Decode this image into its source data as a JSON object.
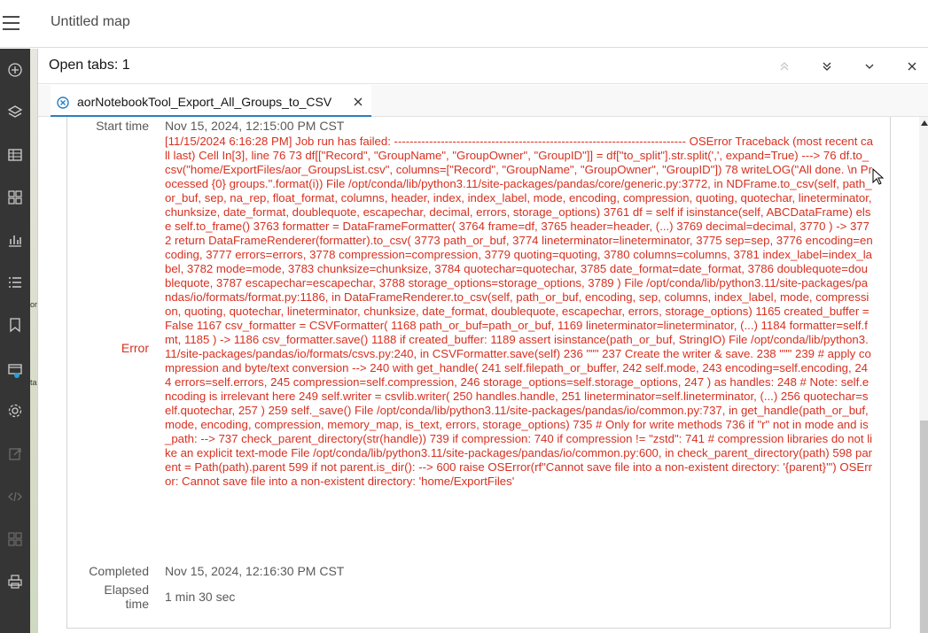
{
  "app": {
    "map_title": "Untitled map"
  },
  "sidebar": {
    "tools": [
      {
        "icon": "add-layer-icon"
      },
      {
        "icon": "layers-icon"
      },
      {
        "icon": "table-icon"
      },
      {
        "icon": "legend-icon"
      },
      {
        "icon": "charts-icon"
      },
      {
        "icon": "list-icon"
      },
      {
        "icon": "bookmark-icon"
      },
      {
        "icon": "task-monitor-icon"
      },
      {
        "icon": "settings-icon"
      },
      {
        "icon": "export-icon"
      },
      {
        "icon": "code-icon"
      },
      {
        "icon": "grid-icon"
      },
      {
        "icon": "print-icon"
      }
    ],
    "map_fragments": [
      "or",
      "ta"
    ]
  },
  "panel": {
    "open_tabs_label": "Open tabs: 1",
    "tab": {
      "label": "aorNotebookTool_Export_All_Groups_to_CSV",
      "status_icon": "failed-status-icon"
    }
  },
  "details": {
    "start_time_label": "Start time",
    "start_time_value": "Nov 15, 2024, 12:15:00 PM CST",
    "error_label": "Error",
    "error_text": "[11/15/2024 6:16:28 PM] Job run has failed: --------------------------------------------------------------------------- OSError Traceback (most recent call last) Cell In[3], line 76 73 df[[\"Record\", \"GroupName\", \"GroupOwner\", \"GroupID\"]] = df[\"to_split\"].str.split(',', expand=True) ---> 76 df.to_csv(\"home/ExportFiles/aor_GroupsList.csv\", columns=[\"Record\", \"GroupName\", \"GroupOwner\", \"GroupID\"]) 78 writeLOG(\"All done. \\n Processed {0} groups.\".format(i)) File /opt/conda/lib/python3.11/site-packages/pandas/core/generic.py:3772, in NDFrame.to_csv(self, path_or_buf, sep, na_rep, float_format, columns, header, index, index_label, mode, encoding, compression, quoting, quotechar, lineterminator, chunksize, date_format, doublequote, escapechar, decimal, errors, storage_options) 3761 df = self if isinstance(self, ABCDataFrame) else self.to_frame() 3763 formatter = DataFrameFormatter( 3764 frame=df, 3765 header=header, (...) 3769 decimal=decimal, 3770 ) -> 3772 return DataFrameRenderer(formatter).to_csv( 3773 path_or_buf, 3774 lineterminator=lineterminator, 3775 sep=sep, 3776 encoding=encoding, 3777 errors=errors, 3778 compression=compression, 3779 quoting=quoting, 3780 columns=columns, 3781 index_label=index_label, 3782 mode=mode, 3783 chunksize=chunksize, 3784 quotechar=quotechar, 3785 date_format=date_format, 3786 doublequote=doublequote, 3787 escapechar=escapechar, 3788 storage_options=storage_options, 3789 ) File /opt/conda/lib/python3.11/site-packages/pandas/io/formats/format.py:1186, in DataFrameRenderer.to_csv(self, path_or_buf, encoding, sep, columns, index_label, mode, compression, quoting, quotechar, lineterminator, chunksize, date_format, doublequote, escapechar, errors, storage_options) 1165 created_buffer = False 1167 csv_formatter = CSVFormatter( 1168 path_or_buf=path_or_buf, 1169 lineterminator=lineterminator, (...) 1184 formatter=self.fmt, 1185 ) -> 1186 csv_formatter.save() 1188 if created_buffer: 1189 assert isinstance(path_or_buf, StringIO) File /opt/conda/lib/python3.11/site-packages/pandas/io/formats/csvs.py:240, in CSVFormatter.save(self) 236 \"\"\" 237 Create the writer & save. 238 \"\"\" 239 # apply compression and byte/text conversion --> 240 with get_handle( 241 self.filepath_or_buffer, 242 self.mode, 243 encoding=self.encoding, 244 errors=self.errors, 245 compression=self.compression, 246 storage_options=self.storage_options, 247 ) as handles: 248 # Note: self.encoding is irrelevant here 249 self.writer = csvlib.writer( 250 handles.handle, 251 lineterminator=self.lineterminator, (...) 256 quotechar=self.quotechar, 257 ) 259 self._save() File /opt/conda/lib/python3.11/site-packages/pandas/io/common.py:737, in get_handle(path_or_buf, mode, encoding, compression, memory_map, is_text, errors, storage_options) 735 # Only for write methods 736 if \"r\" not in mode and is_path: --> 737 check_parent_directory(str(handle)) 739 if compression: 740 if compression != \"zstd\": 741 # compression libraries do not like an explicit text-mode File /opt/conda/lib/python3.11/site-packages/pandas/io/common.py:600, in check_parent_directory(path) 598 parent = Path(path).parent 599 if not parent.is_dir(): --> 600 raise OSError(rf\"Cannot save file into a non-existent directory: '{parent}'\") OSError: Cannot save file into a non-existent directory: 'home/ExportFiles'",
    "completed_label": "Completed",
    "completed_value": "Nov 15, 2024, 12:16:30 PM CST",
    "elapsed_label_line1": "Elapsed",
    "elapsed_label_line2": "time",
    "elapsed_value": "1 min 30 sec"
  },
  "colors": {
    "error": "#d83020",
    "sidebar_bg": "#353535",
    "accent": "#2a7fc1"
  }
}
